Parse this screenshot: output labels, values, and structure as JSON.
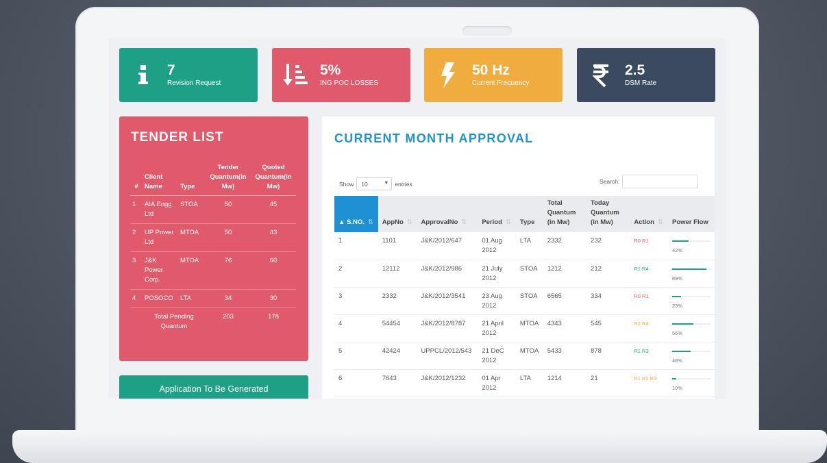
{
  "stats": [
    {
      "value": "7",
      "label": "Revision Request",
      "icon": "info-icon",
      "color": "#1da085"
    },
    {
      "value": "5%",
      "label": "ING POC LOSSES",
      "icon": "sort-down-icon",
      "color": "#e15a6b"
    },
    {
      "value": "50 Hz",
      "label": "Current Frequency",
      "icon": "bolt-icon",
      "color": "#f0ac3f"
    },
    {
      "value": "2.5",
      "label": "DSM Rate",
      "icon": "rupee-icon",
      "color": "#3b4a5f"
    }
  ],
  "tender": {
    "title": "TENDER LIST",
    "headers": {
      "no": "#",
      "client": "Client Name",
      "type": "Type",
      "tender": "Tender Quantum(in Mw)",
      "quoted": "Quoted Quantum(in Mw)"
    },
    "rows": [
      {
        "no": "1",
        "client": "AIA Engg Ltd",
        "type": "STOA",
        "tender": "50",
        "quoted": "45"
      },
      {
        "no": "2",
        "client": "UP Power Ltd",
        "type": "MTOA",
        "tender": "50",
        "quoted": "43"
      },
      {
        "no": "3",
        "client": "J&K Power Corp.",
        "type": "MTOA",
        "tender": "76",
        "quoted": "60"
      },
      {
        "no": "4",
        "client": "POSOCO",
        "type": "LTA",
        "tender": "34",
        "quoted": "30"
      }
    ],
    "total": {
      "label": "Total Pending Quantum",
      "tender": "203",
      "quoted": "178"
    }
  },
  "application": {
    "label": "Application To Be Generated"
  },
  "approval": {
    "title": "CURRENT MONTH APPROVAL",
    "show_label": "Show",
    "entries_value": "10",
    "entries_label": "entries",
    "search_label": "Search:",
    "headers": {
      "sno": "S.NO.",
      "appno": "AppNo",
      "approvalno": "ApprovalNo",
      "period": "Period",
      "type": "Type",
      "total": "Total Quantum (in Mw)",
      "today": "Today Quantum (in Mw)",
      "action": "Action",
      "flow": "Power Flow"
    },
    "rows": [
      {
        "sno": "1",
        "appno": "1101",
        "approvalno": "J&K/2012/647",
        "period": "01 Aug 2012",
        "type": "LTA",
        "total": "2332",
        "today": "232",
        "action": "R0 R1",
        "action_color": "#e15a6b",
        "flow": 0.42,
        "flow_label": "42%"
      },
      {
        "sno": "2",
        "appno": "12112",
        "approvalno": "J&K/2012/986",
        "period": "21 July 2012",
        "type": "STOA",
        "total": "1212",
        "today": "212",
        "action": "R1 R4",
        "action_color": "#1da085",
        "flow": 0.89,
        "flow_label": "89%"
      },
      {
        "sno": "3",
        "appno": "2332",
        "approvalno": "J&K/2012/3541",
        "period": "23 Aug 2012",
        "type": "STOA",
        "total": "6565",
        "today": "334",
        "action": "R0 R1",
        "action_color": "#e15a6b",
        "flow": 0.23,
        "flow_label": "23%"
      },
      {
        "sno": "4",
        "appno": "54454",
        "approvalno": "J&K/2012/8787",
        "period": "21 April 2012",
        "type": "MTOA",
        "total": "4343",
        "today": "545",
        "action": "R2 R4",
        "action_color": "#f0ac3f",
        "flow": 0.56,
        "flow_label": "56%"
      },
      {
        "sno": "5",
        "appno": "42424",
        "approvalno": "UPPCL/2012/543",
        "period": "21 DeC 2012",
        "type": "MTOA",
        "total": "5433",
        "today": "878",
        "action": "R1 R3",
        "action_color": "#1da085",
        "flow": 0.48,
        "flow_label": "48%"
      },
      {
        "sno": "6",
        "appno": "7643",
        "approvalno": "J&K/2012/1232",
        "period": "01 Apr 2012",
        "type": "LTA",
        "total": "1214",
        "today": "21",
        "action": "R1 R2 R3",
        "action_color": "#f0ac3f",
        "flow": 0.1,
        "flow_label": "10%"
      }
    ]
  }
}
